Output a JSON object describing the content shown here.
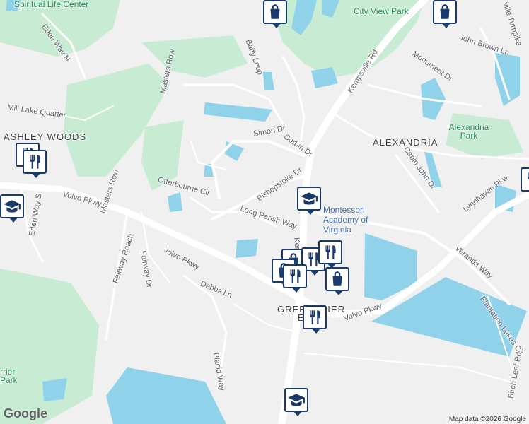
{
  "map": {
    "attribution": "Map data ©2026 Google",
    "logo": "Google",
    "colors": {
      "water": "#8fd2ea",
      "park": "#c8ecd3",
      "road": "#ffffff",
      "background": "#f1f0f1",
      "marker": "#1a3a6b"
    }
  },
  "areas": {
    "ashley_woods": "ASHLEY WOODS",
    "alexandria": "ALEXANDRIA",
    "greenbrier_east": "GREENBRIER EAST"
  },
  "parks": {
    "city_view_park": "City View Park",
    "alexandria_park": "Alexandria Park",
    "spiritual_life_center": "Spiritual Life Center",
    "terrier_park": "rrier Park"
  },
  "roads": {
    "eden_way_n": "Eden Way N",
    "mill_lake_quarter": "Mill Lake Quarter",
    "masters_row_1": "Masters Row",
    "masters_row_2": "Masters Row",
    "eden_way_s": "Eden Way S",
    "volvo_pkwy_1": "Volvo Pkwy",
    "volvo_pkwy_2": "Volvo Pkwy",
    "volvo_pkwy_3": "Volvo Pkwy",
    "fairway_reach": "Fairway Reach",
    "fairway_dr": "Fairway Dr",
    "debbs_ln": "Debbs Ln",
    "placid_way": "Placid Way",
    "otterbourne_cir": "Otterbourne Cir",
    "baffy_loop": "Baffy Loop",
    "simon_dr": "Simon Dr",
    "corbin_dr": "Corbin Dr",
    "bishopstoke_dr": "Bishopstoke Dr",
    "long_parish_way": "Long Parish Way",
    "kempsville_rd_1": "Kempsville Rd",
    "kempsville_rd_2": "Ken",
    "monument_dr": "Monument Dr",
    "john_brown_ln": "John Brown Ln",
    "cabin_john_dr": "Cabin John Dr",
    "lynnhaven_pkwy": "Lynnhaven Pkw",
    "veranda_way": "Veranda Way",
    "plantation_lakes_cir": "Plantation Lakes Cir",
    "birch_leaf_rd": "Birch Leaf Rd",
    "ville_turnpike": "ville Turnpike"
  },
  "pois": {
    "montessori": "Montessori Academy of Virginia"
  },
  "markers": [
    {
      "id": "shop-top",
      "icon": "shopping-bag-icon"
    },
    {
      "id": "shop-topright",
      "icon": "shopping-bag-icon"
    },
    {
      "id": "rest-ashley-1",
      "icon": "restaurant-icon"
    },
    {
      "id": "rest-ashley-2",
      "icon": "restaurant-icon"
    },
    {
      "id": "school-left",
      "icon": "school-icon"
    },
    {
      "id": "school-montessori",
      "icon": "school-icon"
    },
    {
      "id": "shop-cluster-1",
      "icon": "shopping-bag-icon"
    },
    {
      "id": "shop-cluster-2",
      "icon": "shopping-bag-icon"
    },
    {
      "id": "rest-cluster-1",
      "icon": "restaurant-icon"
    },
    {
      "id": "rest-cluster-2",
      "icon": "restaurant-icon"
    },
    {
      "id": "rest-cluster-3",
      "icon": "restaurant-icon"
    },
    {
      "id": "shop-cluster-3",
      "icon": "shopping-bag-icon"
    },
    {
      "id": "rest-greenbrier",
      "icon": "restaurant-icon"
    },
    {
      "id": "school-bottom",
      "icon": "school-icon"
    },
    {
      "id": "rest-right-edge",
      "icon": "restaurant-icon"
    }
  ]
}
